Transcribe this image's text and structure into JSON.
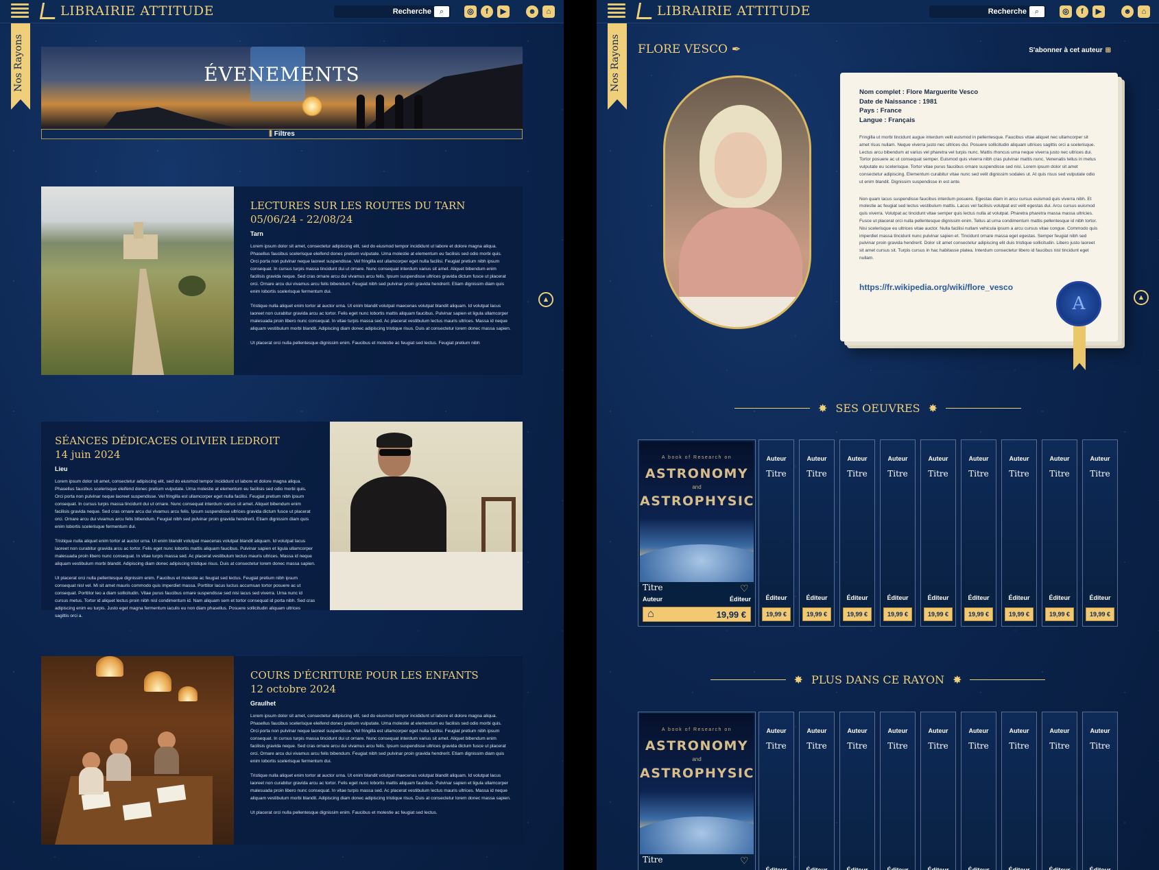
{
  "header": {
    "brand": "LIBRAIRIE ATTITUDE",
    "search_placeholder": "Recherche",
    "side_tab": "Nos Rayons",
    "icons": [
      "instagram-icon",
      "facebook-icon",
      "youtube-icon",
      "account-icon",
      "basket-icon"
    ]
  },
  "events_page": {
    "hero_title": "ÉVENEMENTS",
    "filters_label": "Filtres",
    "events": [
      {
        "title": "LECTURES SUR LES ROUTES DU TARN",
        "date": "05/06/24 - 22/08/24",
        "place": "Tarn",
        "p1": "Lorem ipsum dolor sit amet, consectetur adipiscing elit, sed do eiusmod tempor incididunt ut labore et dolore magna aliqua. Phasellus faucibus scelerisque eleifend donec pretium vulputate. Urna molestie at elementum eu facilisis sed odio morbi quis. Orci porta non pulvinar neque laoreet suspendisse. Vel fringilla est ullamcorper eget nulla facilisi. Feugiat pretium nibh ipsum consequat. In cursus turpis massa tincidunt dui ut ornare. Nunc consequat interdum varius sit amet. Aliquet bibendum enim facilisis gravida neque. Sed cras ornare arcu dui vivamus arcu felis. Ipsum suspendisse ultrices gravida dictum fusce ut placerat orci. Ornare arcu dui vivamus arcu felis bibendum. Feugiat nibh sed pulvinar proin gravida hendrerit. Etiam dignissim diam quis enim lobortis scelerisque fermentum dui.",
        "p2": "Tristique nulla aliquet enim tortor at auctor urna. Ut enim blandit volutpat maecenas volutpat blandit aliquam. Id volutpat lacus laoreet non curabitur gravida arcu ac tortor. Felis eget nunc lobortis mattis aliquam faucibus. Pulvinar sapien et ligula ullamcorper malesuada proin libero nunc consequat. In vitae turpis massa sed. Ac placerat vestibulum lectus mauris ultrices. Massa id neque aliquam vestibulum morbi blandit. Adipiscing diam donec adipiscing tristique risus. Duis at consectetur lorem donec massa sapien.",
        "p3": "Ut placerat orci nulla pellentesque dignissim enim. Faucibus et molestie ac feugiat sed lectus. Feugiat pretium nibh"
      },
      {
        "title": "SÉANCES DÉDICACES OLIVIER LEDROIT",
        "date": "14 juin 2024",
        "place": "Lieu",
        "p1": "Lorem ipsum dolor sit amet, consectetur adipiscing elit, sed do eiusmod tempor incididunt ut labore et dolore magna aliqua. Phasellus faucibus scelerisque eleifend donec pretium vulputate. Urna molestie at elementum eu facilisis sed odio morbi quis. Orci porta non pulvinar neque laoreet suspendisse. Vel fringilla est ullamcorper eget nulla facilisi. Feugiat pretium nibh ipsum consequat. In cursus turpis massa tincidunt dui ut ornare. Nunc consequat interdum varius sit amet. Aliquet bibendum enim facilisis gravida neque. Sed cras ornare arcu dui vivamus arcu felis. Ipsum suspendisse ultrices gravida dictum fusce ut placerat orci. Ornare arcu dui vivamus arcu felis bibendum. Feugiat nibh sed pulvinar proin gravida hendrerit. Etiam dignissim diam quis enim lobortis scelerisque fermentum dui.",
        "p2": "Tristique nulla aliquet enim tortor at auctor urna. Ut enim blandit volutpat maecenas volutpat blandit aliquam. Id volutpat lacus laoreet non curabitur gravida arcu ac tortor. Felis eget nunc lobortis mattis aliquam faucibus. Pulvinar sapien et ligula ullamcorper malesuada proin libero nunc consequat. In vitae turpis massa sed. Ac placerat vestibulum lectus mauris ultrices. Massa id neque aliquam vestibulum morbi blandit. Adipiscing diam donec adipiscing tristique risus. Duis at consectetur lorem donec massa sapien.",
        "p3": "Ut placerat orci nulla pellentesque dignissim enim. Faucibus et molestie ac feugiat sed lectus. Feugiat pretium nibh ipsum consequat nisl vel. Mi sit amet mauris commodo quis imperdiet massa. Porttitor lacus luctus accumsan tortor posuere ac ut consequat. Porttitor leo a diam sollicitudin. Vitae purus faucibus ornare suspendisse sed nisi lacus sed viverra. Urna nunc id cursus metus. Tortor id aliquet lectus proin nibh nisl condimentum id. Nam aliquam sem et tortor consequat id porta nibh. Sed cras adipiscing enim eu turpis. Justo eget magna fermentum iaculis eu non diam phasellus. Posuere sollicitudin aliquam ultrices sagittis orci a."
      },
      {
        "title": "COURS D'ÉCRITURE POUR LES ENFANTS",
        "date": "12 octobre 2024",
        "place": "Graulhet",
        "p1": "Lorem ipsum dolor sit amet, consectetur adipiscing elit, sed do eiusmod tempor incididunt ut labore et dolore magna aliqua. Phasellus faucibus scelerisque eleifend donec pretium vulputate. Urna molestie at elementum eu facilisis sed odio morbi quis. Orci porta non pulvinar neque laoreet suspendisse. Vel fringilla est ullamcorper eget nulla facilisi. Feugiat pretium nibh ipsum consequat. In cursus turpis massa tincidunt dui ut ornare. Nunc consequat interdum varius sit amet. Aliquet bibendum enim facilisis gravida neque. Sed cras ornare arcu dui vivamus arcu felis. Ipsum suspendisse ultrices gravida dictum fusce ut placerat orci. Ornare arcu dui vivamus arcu felis bibendum. Feugiat nibh sed pulvinar proin gravida hendrerit. Etiam dignissim diam quis enim lobortis scelerisque fermentum dui.",
        "p2": "Tristique nulla aliquet enim tortor at auctor urna. Ut enim blandit volutpat maecenas volutpat blandit aliquam. Id volutpat lacus laoreet non curabitur gravida arcu ac tortor. Felis eget nunc lobortis mattis aliquam faucibus. Pulvinar sapien et ligula ullamcorper malesuada proin libero nunc consequat. In vitae turpis massa sed. Ac placerat vestibulum lectus mauris ultrices. Massa id neque aliquam vestibulum morbi blandit. Adipiscing diam donec adipiscing tristique risus. Duis at consectetur lorem donec massa sapien.",
        "p3": "Ut placerat orci nulla pellentesque dignissim enim. Faucibus et molestie ac feugiat sed lectus."
      }
    ]
  },
  "author_page": {
    "name": "FLORE VESCO",
    "subscribe": "S'abonner à cet auteur",
    "facts": {
      "full_name": "Nom complet : Flore Marguerite Vesco",
      "birth": "Date de Naissance : 1981",
      "country": "Pays : France",
      "language": "Langue : Français"
    },
    "bio1": "Fringilla ut morbi tincidunt augue interdum velit euismod in pellentesque. Faucibus vitae aliquet nec ullamcorper sit amet risus nullam. Neque viverra justo nec ultrices dui. Posuere sollicitudin aliquam ultrices sagittis orci a scelerisque. Lectus arcu bibendum at varius vel pharetra vel turpis nunc. Mattis rhoncus urna neque viverra justo nec ultrices dui. Tortor posuere ac ut consequat semper. Euismod quis viverra nibh cras pulvinar mattis nunc. Venenatis tellus in metus vulputate eu scelerisque. Tortor vitae purus faucibus ornare suspendisse sed nisi. Lorem ipsum dolor sit amet consectetur adipiscing. Elementum curabitur vitae nunc sed velit dignissim sodales ut. At quis risus sed vulputate odio ut enim blandit. Dignissim suspendisse in est ante.",
    "bio2": "Non quam lacus suspendisse faucibus interdum posuere. Egestas diam in arcu cursus euismod quis viverra nibh. Et molestie ac feugiat sed lectus vestibulum mattis. Lacus vel facilisis volutpat est velit egestas dui. Arcu cursus euismod quis viverra. Volutpat ac tincidunt vitae semper quis lectus nulla at volutpat. Pharetra pharetra massa massa ultricies. Fusce ut placerat orci nulla pellentesque dignissim enim. Tellus at urna condimentum mattis pellentesque id nibh tortor. Nisi scelerisque eu ultrices vitae auctor. Nulla facilisi nullam vehicula ipsum a arcu cursus vitae congue. Commodo quis imperdiet massa tincidunt nunc pulvinar sapien et. Tincidunt ornare massa eget egestas. Semper feugiat nibh sed pulvinar proin gravida hendrerit. Dolor sit amet consectetur adipiscing elit duis tristique sollicitudin. Libero justo laoreet sit amet cursus sit. Turpis cursus in hac habitasse platea. Interdum consectetur libero id faucibus nisl tincidunt eget nullam.",
    "wiki_url": "https://fr.wikipedia.org/wiki/flore_vesco",
    "seal_letter": "A",
    "section_works": "SES OEUVRES",
    "section_more": "PLUS DANS CE RAYON",
    "featured_book": {
      "cover_sub": "A book of Research on",
      "cover_t1": "ASTRONOMY",
      "cover_and": "and",
      "cover_t2": "ASTROPHYSICS",
      "title": "Titre",
      "author": "Auteur",
      "publisher": "Éditeur",
      "price": "19,99 €"
    },
    "spine": {
      "author": "Auteur",
      "title": "Titre",
      "publisher": "Éditeur",
      "price": "19,99 €"
    }
  }
}
